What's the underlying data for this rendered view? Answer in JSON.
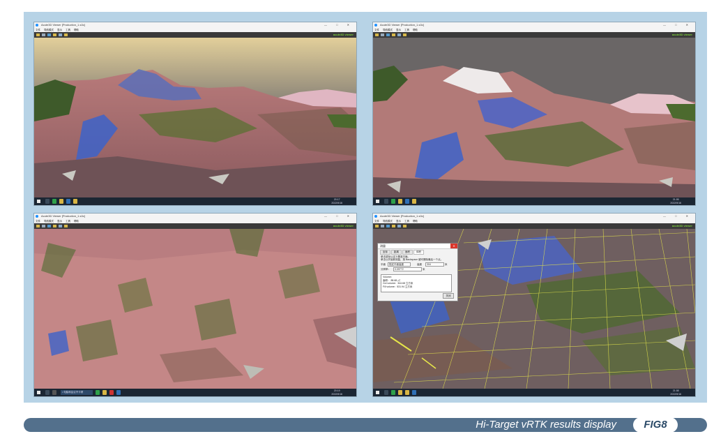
{
  "app": {
    "window_title": "Acute3D Viewer [Production_1.s3c]",
    "window_controls": "—  □  ✕",
    "menu": [
      "文件",
      "导航模式",
      "显示",
      "工具",
      "帮助"
    ],
    "brand": "acute3D viewer"
  },
  "screens": [
    {
      "clock_time": "20:17",
      "clock_date": "2022/5/16",
      "view": "terrain-overview"
    },
    {
      "clock_time": "21:05",
      "clock_date": "2022/5/16",
      "view": "slope-closeup"
    },
    {
      "clock_time": "20:19",
      "clock_date": "2022/5/16",
      "view": "surface-detail",
      "task_label": "• 电脑和会议不卡顿"
    },
    {
      "clock_time": "21:08",
      "clock_date": "2022/5/16",
      "view": "measurement-grid"
    }
  ],
  "dialog": {
    "title": "测量",
    "close": "✕",
    "tabs": [
      "坐标",
      "距离",
      "面积",
      "体积"
    ],
    "line1": "单击鼠标以定义基准平面。",
    "line2": "单击以开始新测量，按 Backspace 键可删除最后一个点。",
    "plane_label": "平面",
    "plane_value": "指定平面高度",
    "height_label": "高度",
    "height_value": "304",
    "height_unit": "米",
    "resolution_label": "分辨率：",
    "resolution_value": "0.09772",
    "resolution_unit": "米",
    "results": [
      "Volume：",
      "  面积：  88.68 ㎡",
      "  Cut volume：344.68 立方米",
      "  Fill volume：531.94 立方米"
    ],
    "ok": "关闭"
  },
  "caption": {
    "text": "Hi-Target vRTK results display",
    "fig": "FIG8"
  },
  "colors": {
    "frame_bg": "#b7d3e6",
    "caption_bar": "#53708c",
    "terrain_pink": "#c98a8a",
    "vegetation": "#4c6a2e",
    "water_blue": "#4a6fd0",
    "grid_yellow": "#e6e64a"
  }
}
